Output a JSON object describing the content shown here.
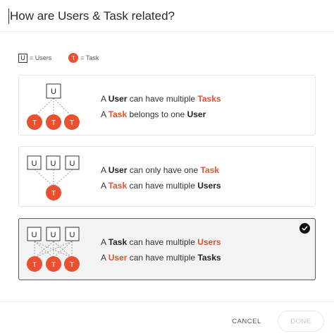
{
  "dialog": {
    "title": "How are Users & Task related?"
  },
  "legend": {
    "user_glyph": "U",
    "user_label": "= Users",
    "task_glyph": "T",
    "task_label": "= Task"
  },
  "options": [
    {
      "diagram": "one-user-to-many-tasks",
      "selected": false,
      "lines": [
        [
          {
            "t": "A "
          },
          {
            "t": "User",
            "b": true
          },
          {
            "t": " can have multiple "
          },
          {
            "t": "Tasks",
            "b": true,
            "hl": true
          }
        ],
        [
          {
            "t": "A "
          },
          {
            "t": "Task",
            "b": true,
            "hl": true
          },
          {
            "t": " belongs to one "
          },
          {
            "t": "User",
            "b": true
          }
        ]
      ]
    },
    {
      "diagram": "many-users-to-one-task",
      "selected": false,
      "lines": [
        [
          {
            "t": "A "
          },
          {
            "t": "User",
            "b": true
          },
          {
            "t": " can only have one "
          },
          {
            "t": "Task",
            "b": true,
            "hl": true
          }
        ],
        [
          {
            "t": "A "
          },
          {
            "t": "Task",
            "b": true,
            "hl": true
          },
          {
            "t": " can have multiple "
          },
          {
            "t": "Users",
            "b": true
          }
        ]
      ]
    },
    {
      "diagram": "many-users-to-many-tasks",
      "selected": true,
      "lines": [
        [
          {
            "t": "A "
          },
          {
            "t": "Task",
            "b": true
          },
          {
            "t": " can have multiple "
          },
          {
            "t": "Users",
            "b": true,
            "hl": true
          }
        ],
        [
          {
            "t": "A "
          },
          {
            "t": "User",
            "b": true,
            "hl": true
          },
          {
            "t": " can have multiple "
          },
          {
            "t": "Tasks",
            "b": true
          }
        ]
      ]
    }
  ],
  "footer": {
    "cancel_label": "CANCEL",
    "done_label": "DONE"
  },
  "colors": {
    "accent": "#e8502f",
    "selected_bg": "#f3f3f3",
    "selected_border": "#5a5a5a"
  }
}
